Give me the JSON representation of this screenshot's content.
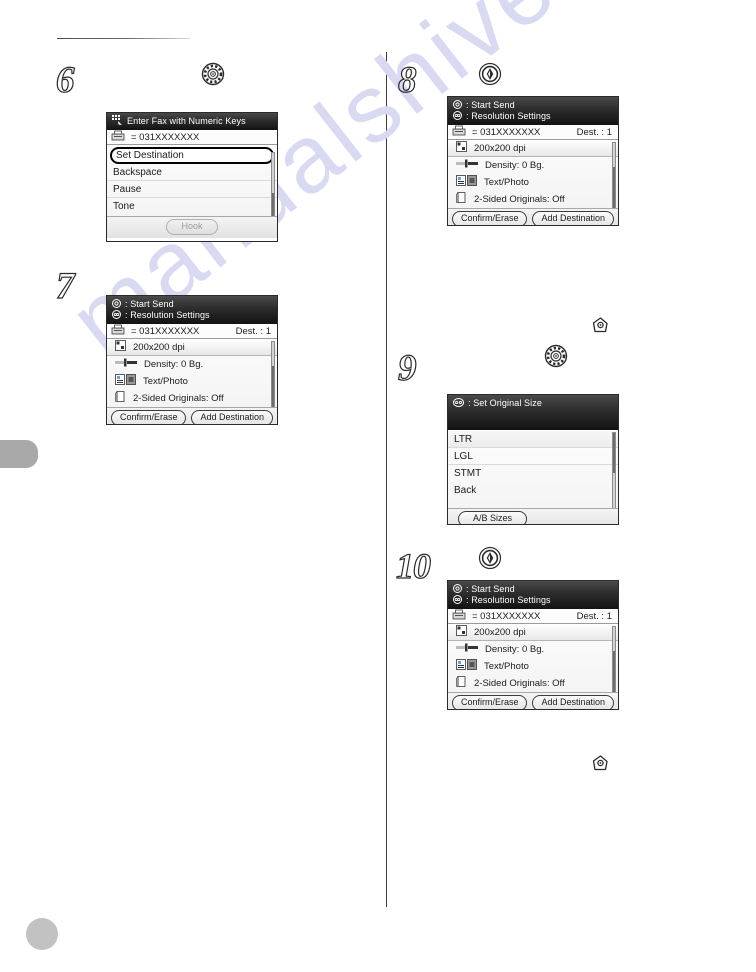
{
  "page": {
    "watermark": "manualshive.com",
    "header_rule": true
  },
  "steps": [
    {
      "id": "step-6",
      "number": "6",
      "key_icon": "dpad-ok-icon",
      "panel": {
        "type": "menu-list",
        "title": "Enter Fax with Numeric Keys",
        "title_icon": "numeric-keys-icon",
        "destination": "= 031XXXXXXX",
        "destination_icon": "fax-machine-icon",
        "items": [
          "Set Destination",
          "Backspace",
          "Pause",
          "Tone"
        ],
        "selected_item": "Set Destination",
        "softkeys": [
          {
            "label": "Hook",
            "state": "disabled"
          }
        ]
      }
    },
    {
      "id": "step-7",
      "number": "7",
      "key_icon": null,
      "panel": {
        "type": "send-settings",
        "title_lines": [
          {
            "icon": "start-send-icon",
            "text": ": Start Send"
          },
          {
            "icon": "resolution-icon",
            "text": ": Resolution Settings"
          }
        ],
        "destination": "= 031XXXXXXX",
        "destination_icon": "fax-machine-icon",
        "dest_count": "Dest.  : 1",
        "rows": [
          {
            "icon": "resolution-grid-icon",
            "label": "200x200 dpi",
            "selected": true
          },
          {
            "icon": "density-slider-icon",
            "label": "Density: 0 Bg.",
            "selected": false
          },
          {
            "icon": "text-photo-icon",
            "label": "Text/Photo",
            "selected": false
          },
          {
            "icon": "two-sided-icon",
            "label": "2-Sided Originals: Off",
            "selected": false
          }
        ],
        "softkeys": [
          {
            "label": "Confirm/Erase",
            "state": "enabled"
          },
          {
            "label": "Add Destination",
            "state": "enabled"
          }
        ]
      }
    },
    {
      "id": "step-8",
      "number": "8",
      "key_icon": "start-button-icon",
      "panel": {
        "type": "send-settings",
        "title_lines": [
          {
            "icon": "start-send-icon",
            "text": ": Start Send"
          },
          {
            "icon": "resolution-icon",
            "text": ": Resolution Settings"
          }
        ],
        "destination": "= 031XXXXXXX",
        "destination_icon": "fax-machine-icon",
        "dest_count": "Dest.  : 1",
        "rows": [
          {
            "icon": "resolution-grid-icon",
            "label": "200x200 dpi",
            "selected": true
          },
          {
            "icon": "density-slider-icon",
            "label": "Density: 0 Bg.",
            "selected": false
          },
          {
            "icon": "text-photo-icon",
            "label": "Text/Photo",
            "selected": false
          },
          {
            "icon": "two-sided-icon",
            "label": "2-Sided Originals: Off",
            "selected": false
          }
        ],
        "softkeys": [
          {
            "label": "Confirm/Erase",
            "state": "enabled"
          },
          {
            "label": "Add Destination",
            "state": "enabled"
          }
        ]
      }
    },
    {
      "id": "step-9",
      "number": "9",
      "key_icon": "dpad-ok-icon",
      "note_icon": "platen-glass-icon",
      "panel": {
        "type": "menu-list",
        "title": ": Set Original Size",
        "title_icon": "original-size-icon",
        "items": [
          "LTR",
          "LGL",
          "STMT",
          "Back"
        ],
        "selected_item": null,
        "softkeys": [
          {
            "label": "A/B Sizes",
            "state": "enabled"
          }
        ]
      }
    },
    {
      "id": "step-10",
      "number": "10",
      "key_icon": "start-button-icon",
      "note_icon": "platen-glass-icon",
      "panel": {
        "type": "send-settings",
        "title_lines": [
          {
            "icon": "start-send-icon",
            "text": ": Start Send"
          },
          {
            "icon": "resolution-icon",
            "text": ": Resolution Settings"
          }
        ],
        "destination": "= 031XXXXXXX",
        "destination_icon": "fax-machine-icon",
        "dest_count": "Dest.  : 1",
        "rows": [
          {
            "icon": "resolution-grid-icon",
            "label": "200x200 dpi",
            "selected": true
          },
          {
            "icon": "density-slider-icon",
            "label": "Density: 0 Bg.",
            "selected": false
          },
          {
            "icon": "text-photo-icon",
            "label": "Text/Photo",
            "selected": false
          },
          {
            "icon": "two-sided-icon",
            "label": "2-Sided Originals: Off",
            "selected": false
          }
        ],
        "softkeys": [
          {
            "label": "Confirm/Erase",
            "state": "enabled"
          },
          {
            "label": "Add Destination",
            "state": "enabled"
          }
        ]
      }
    }
  ]
}
